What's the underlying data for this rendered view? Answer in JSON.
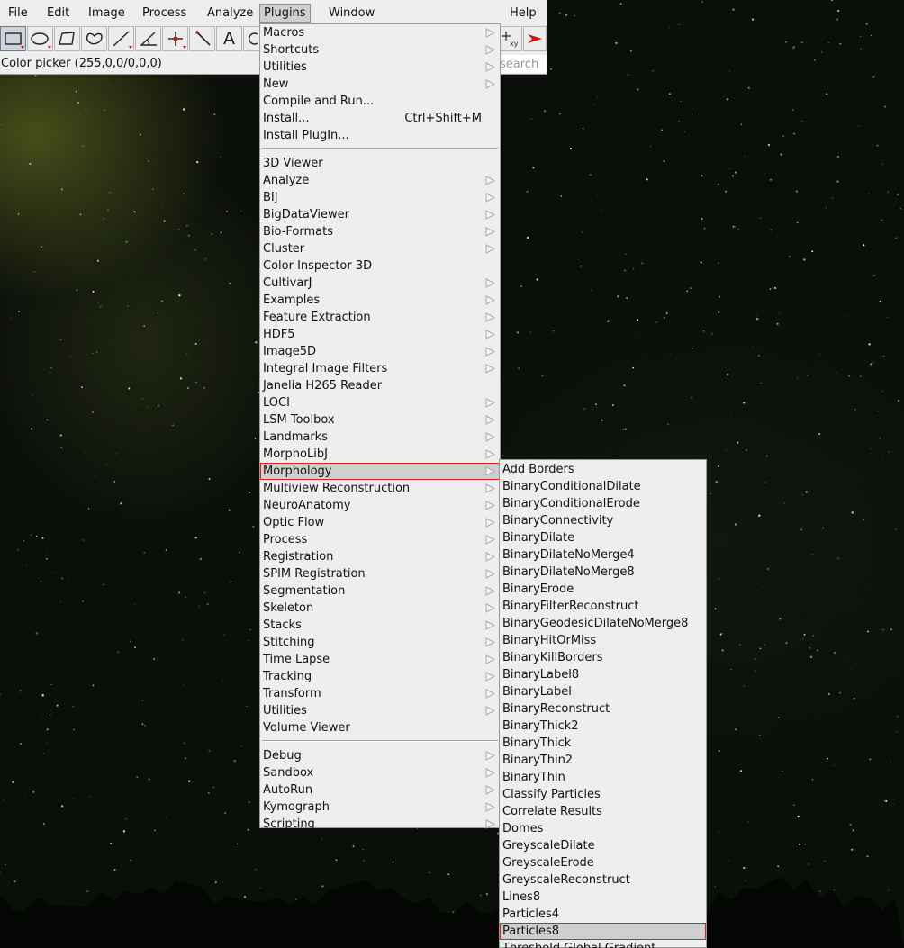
{
  "menubar": [
    "File",
    "Edit",
    "Image",
    "Process",
    "Analyze",
    "Plugins",
    "Window",
    "Help"
  ],
  "active_menu": "Plugins",
  "toolbar": {
    "tools": [
      "rectangle-tool-icon",
      "oval-tool-icon",
      "polygon-tool-icon",
      "freehand-tool-icon",
      "line-tool-icon",
      "angle-tool-icon",
      "point-tool-icon",
      "wand-tool-icon",
      "text-tool-icon",
      "magnifier-tool-icon",
      "color-picker-xy-icon",
      "more-tools-arrow-icon"
    ],
    "text_tool_glyph": "A",
    "xy_glyph": "xy"
  },
  "status_text": "Color picker (255,0,0/0,0,0)",
  "search": {
    "placeholder": "search"
  },
  "plugins_menu": {
    "group1": [
      {
        "label": "Macros",
        "submenu": true
      },
      {
        "label": "Shortcuts",
        "submenu": true
      },
      {
        "label": "Utilities",
        "submenu": true
      },
      {
        "label": "New",
        "submenu": true
      },
      {
        "label": "Compile and Run...",
        "submenu": false
      },
      {
        "label": "Install...",
        "submenu": false,
        "shortcut": "Ctrl+Shift+M"
      },
      {
        "label": "Install PlugIn...",
        "submenu": false
      }
    ],
    "group2": [
      {
        "label": "3D Viewer",
        "submenu": false
      },
      {
        "label": "Analyze",
        "submenu": true
      },
      {
        "label": "BIJ",
        "submenu": true
      },
      {
        "label": "BigDataViewer",
        "submenu": true
      },
      {
        "label": "Bio-Formats",
        "submenu": true
      },
      {
        "label": "Cluster",
        "submenu": true
      },
      {
        "label": "Color Inspector 3D",
        "submenu": false
      },
      {
        "label": "CultivarJ",
        "submenu": true
      },
      {
        "label": "Examples",
        "submenu": true
      },
      {
        "label": "Feature Extraction",
        "submenu": true
      },
      {
        "label": "HDF5",
        "submenu": true
      },
      {
        "label": "Image5D",
        "submenu": true
      },
      {
        "label": "Integral Image Filters",
        "submenu": true
      },
      {
        "label": "Janelia H265 Reader",
        "submenu": false
      },
      {
        "label": "LOCI",
        "submenu": true
      },
      {
        "label": "LSM Toolbox",
        "submenu": true
      },
      {
        "label": "Landmarks",
        "submenu": true
      },
      {
        "label": "MorphoLibJ",
        "submenu": true
      },
      {
        "label": "Morphology",
        "submenu": true,
        "highlighted": true
      },
      {
        "label": "Multiview Reconstruction",
        "submenu": true
      },
      {
        "label": "NeuroAnatomy",
        "submenu": true
      },
      {
        "label": "Optic Flow",
        "submenu": true
      },
      {
        "label": "Process",
        "submenu": true
      },
      {
        "label": "Registration",
        "submenu": true
      },
      {
        "label": "SPIM Registration",
        "submenu": true
      },
      {
        "label": "Segmentation",
        "submenu": true
      },
      {
        "label": "Skeleton",
        "submenu": true
      },
      {
        "label": "Stacks",
        "submenu": true
      },
      {
        "label": "Stitching",
        "submenu": true
      },
      {
        "label": "Time Lapse",
        "submenu": true
      },
      {
        "label": "Tracking",
        "submenu": true
      },
      {
        "label": "Transform",
        "submenu": true
      },
      {
        "label": "Utilities",
        "submenu": true
      },
      {
        "label": "Volume Viewer",
        "submenu": false
      }
    ],
    "group3": [
      {
        "label": "Debug",
        "submenu": true
      },
      {
        "label": "Sandbox",
        "submenu": true
      },
      {
        "label": "AutoRun",
        "submenu": true
      },
      {
        "label": "Kymograph",
        "submenu": true
      },
      {
        "label": "Scripting",
        "submenu": true
      }
    ]
  },
  "morphology_menu": [
    {
      "label": "Add Borders"
    },
    {
      "label": "BinaryConditionalDilate"
    },
    {
      "label": "BinaryConditionalErode"
    },
    {
      "label": "BinaryConnectivity"
    },
    {
      "label": "BinaryDilate"
    },
    {
      "label": "BinaryDilateNoMerge4"
    },
    {
      "label": "BinaryDilateNoMerge8"
    },
    {
      "label": "BinaryErode"
    },
    {
      "label": "BinaryFilterReconstruct"
    },
    {
      "label": "BinaryGeodesicDilateNoMerge8"
    },
    {
      "label": "BinaryHitOrMiss"
    },
    {
      "label": "BinaryKillBorders"
    },
    {
      "label": "BinaryLabel8"
    },
    {
      "label": "BinaryLabel"
    },
    {
      "label": "BinaryReconstruct"
    },
    {
      "label": "BinaryThick2"
    },
    {
      "label": "BinaryThick"
    },
    {
      "label": "BinaryThin2"
    },
    {
      "label": "BinaryThin"
    },
    {
      "label": "Classify Particles"
    },
    {
      "label": "Correlate Results"
    },
    {
      "label": "Domes"
    },
    {
      "label": "GreyscaleDilate"
    },
    {
      "label": "GreyscaleErode"
    },
    {
      "label": "GreyscaleReconstruct"
    },
    {
      "label": "Lines8"
    },
    {
      "label": "Particles4"
    },
    {
      "label": "Particles8",
      "highlighted": true
    },
    {
      "label": "Threshold Global Gradient"
    }
  ],
  "colors": {
    "menu_bg": "#eeeeee",
    "highlight_bg": "#cfcfcf",
    "highlight_outline": "#dd2222",
    "tool_red": "#cc1111"
  }
}
